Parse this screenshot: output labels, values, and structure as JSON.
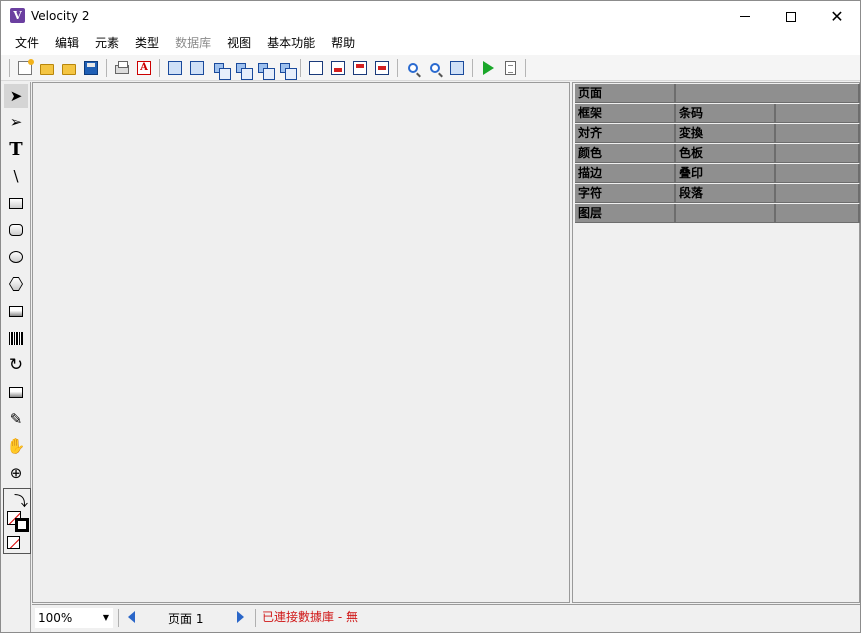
{
  "window": {
    "title": "Velocity 2",
    "icon_letter": "V",
    "icon_color": "#6b3fa0"
  },
  "menu": [
    {
      "label": "文件",
      "enabled": true
    },
    {
      "label": "编辑",
      "enabled": true
    },
    {
      "label": "元素",
      "enabled": true
    },
    {
      "label": "类型",
      "enabled": true
    },
    {
      "label": "数据库",
      "enabled": false
    },
    {
      "label": "视图",
      "enabled": true
    },
    {
      "label": "基本功能",
      "enabled": true
    },
    {
      "label": "帮助",
      "enabled": true
    }
  ],
  "toolbar_icons": [
    "new-document-icon",
    "open-folder-icon",
    "open-template-icon",
    "save-icon",
    "print-icon",
    "export-pdf-icon",
    "fit-page-icon",
    "fit-selection-icon",
    "bring-front-icon",
    "send-back-icon",
    "bring-forward-icon",
    "send-backward-icon",
    "frame-icon",
    "align-bottom-icon",
    "align-top-icon",
    "align-middle-icon",
    "zoom-in-icon",
    "zoom-out-icon",
    "zoom-fit-icon",
    "run-icon",
    "report-icon"
  ],
  "tools": [
    "select-tool",
    "direct-select-tool",
    "text-tool",
    "line-tool",
    "rectangle-tool",
    "rounded-rectangle-tool",
    "ellipse-tool",
    "polygon-tool",
    "image-tool",
    "barcode-tool",
    "rotate-tool",
    "crop-tool",
    "eyedropper-tool",
    "pan-tool",
    "zoom-tool"
  ],
  "tool_glyphs": {
    "text": "T",
    "line": "\\",
    "rotate": "↻",
    "eyedropper": "✎",
    "hand": "✋",
    "zoom": "⊕",
    "swap": "⤵"
  },
  "properties": {
    "page": "页面",
    "frame": "框架",
    "barcode": "条码",
    "align": "対齐",
    "transform": "変換",
    "color": "颜色",
    "palette": "色板",
    "stroke": "描边",
    "overprint": "叠印",
    "character": "字符",
    "paragraph": "段落",
    "layer": "图层"
  },
  "status": {
    "zoom": "100%",
    "page": "页面 1",
    "db_connection": "已連接數據庫 - 無",
    "db_color": "#d01818"
  }
}
